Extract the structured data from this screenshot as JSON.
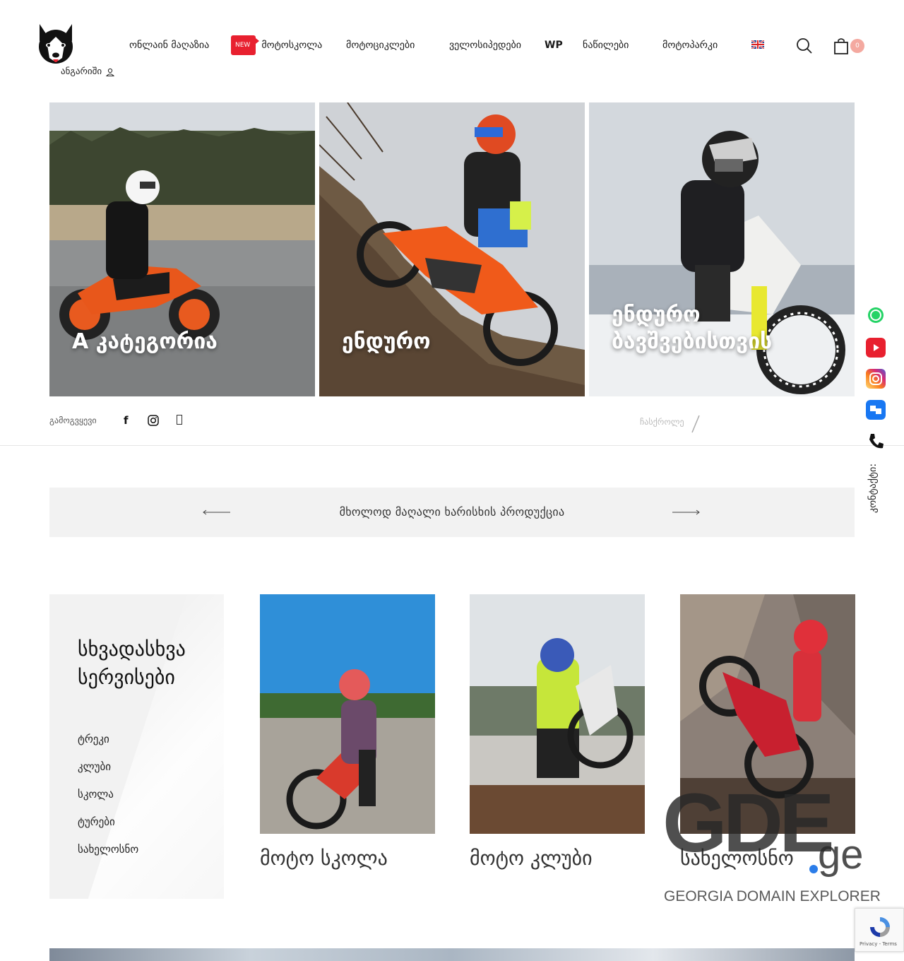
{
  "header": {
    "account_label": "ანგარიში",
    "nav": [
      {
        "label": "ონლაინ მაღაზია"
      },
      {
        "label": "მოტოსკოლა",
        "badge": "NEW"
      },
      {
        "label": "მოტოციკლები"
      },
      {
        "label": "ველოსიპედები"
      },
      {
        "label": "WP"
      },
      {
        "label": "ნაწილები"
      },
      {
        "label": "მოტოპარკი"
      }
    ],
    "cart_count": "0",
    "language_icon": "uk-flag-icon"
  },
  "slider": {
    "slides": [
      {
        "title": "A კატეგორია"
      },
      {
        "title": "ენდურო"
      },
      {
        "title": "ენდურო ბავშვებისთვის"
      }
    ],
    "dot_count": 4
  },
  "follow": {
    "label": "გამოგვყევი",
    "facebook": "f",
    "scroll_label": "ჩასქროლე"
  },
  "banner": {
    "text": "მხოლოდ მაღალი ხარისხის პროდუქცია"
  },
  "services": {
    "title_line1": "სხვადასხვა",
    "title_line2": "სერვისები",
    "items": [
      "ტრეკი",
      "კლუბი",
      "სკოლა",
      "ტურები",
      "სახელოსნო"
    ]
  },
  "cards": [
    {
      "title": "მოტო სკოლა"
    },
    {
      "title": "მოტო კლუბი"
    },
    {
      "title": "სახელოსნო"
    }
  ],
  "contact": {
    "label": "კონტაქტი:"
  },
  "watermark": {
    "big": "GDE",
    "tld": "ge",
    "subtitle": "GEORGIA DOMAIN EXPLORER"
  },
  "recaptcha": {
    "privacy": "Privacy",
    "terms": "Terms"
  },
  "colors": {
    "accent_red": "#e8202f",
    "cart_badge": "#f4a9a0",
    "banner_bg": "#f2f2f2"
  }
}
